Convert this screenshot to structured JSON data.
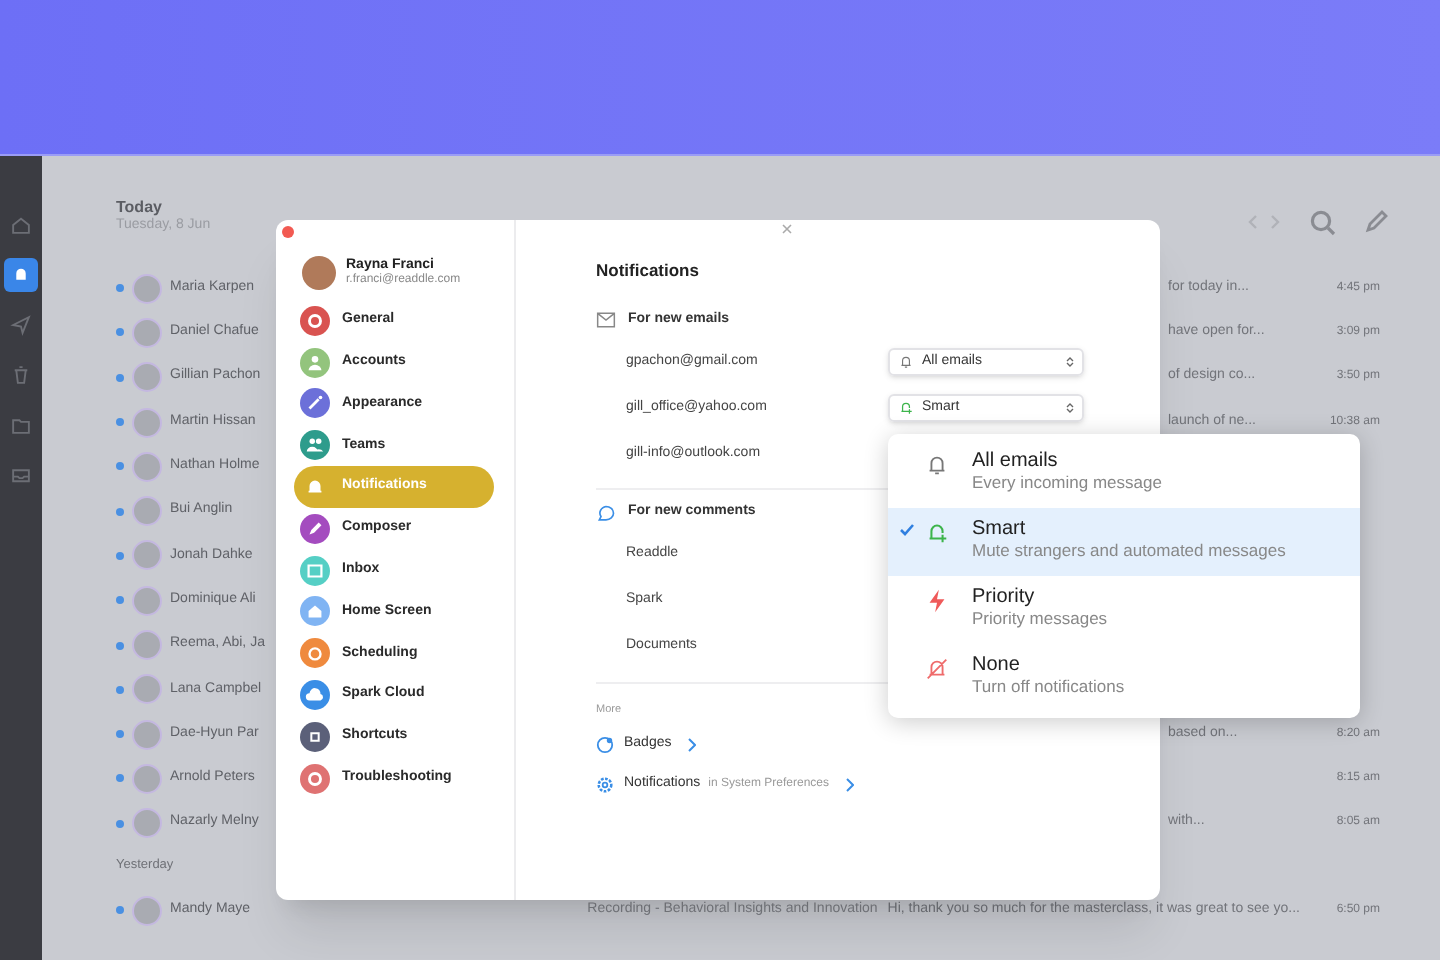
{
  "rail_items": [
    {
      "kind": "home",
      "selected": false
    },
    {
      "kind": "bell",
      "selected": true
    },
    {
      "kind": "send",
      "selected": false
    },
    {
      "kind": "trash",
      "selected": false
    },
    {
      "kind": "folder",
      "selected": false
    },
    {
      "kind": "tray",
      "selected": false
    }
  ],
  "mail_list": {
    "today_label": "Today",
    "date": "Tuesday, 8 Jun",
    "rows": [
      {
        "name": "Maria Karpen",
        "snippet": "for today in...",
        "time": "4:45 pm",
        "unread": true
      },
      {
        "name": "Daniel Chafue",
        "snippet": "have open for...",
        "time": "3:09 pm",
        "unread": true
      },
      {
        "name": "Gillian Pachon",
        "snippet": "of design co...",
        "time": "3:50 pm",
        "unread": true
      },
      {
        "name": "Martin Hissan",
        "snippet": "launch of ne...",
        "time": "10:38 am",
        "unread": true
      },
      {
        "name": "Nathan Holme",
        "unread": true
      },
      {
        "name": "Bui Anglin",
        "unread": true
      },
      {
        "name": "Jonah Dahke",
        "unread": true
      },
      {
        "name": "Dominique Ali",
        "unread": true
      },
      {
        "name": "Reema, Abi, Ja",
        "unread": true
      },
      {
        "name": "Lana Campbel",
        "unread": true
      },
      {
        "name": "Dae-Hyun Par",
        "snippet": "based on...",
        "time": "8:20 am",
        "unread": true
      },
      {
        "name": "Arnold Peters",
        "time": "8:15 am",
        "unread": true
      },
      {
        "name": "Nazarly Melny",
        "snippet": "with...",
        "time": "8:05 am",
        "unread": true
      }
    ],
    "yesterday_label": "Yesterday",
    "yesterday_rows": [
      {
        "name": "Mandy Maye",
        "subject": "Recording - Behavioral Insights and Innovation",
        "snippet": "Hi, thank you so much for the masterclass, it was great to see yo...",
        "time": "6:50 pm",
        "unread": true
      }
    ]
  },
  "settings": {
    "account": {
      "name": "Rayna Franci",
      "email": "r.franci@readdle.com"
    },
    "nav": [
      {
        "label": "General",
        "color": "#d95350",
        "selected": false
      },
      {
        "label": "Accounts",
        "color": "#93c47d",
        "selected": false
      },
      {
        "label": "Appearance",
        "color": "#6c70d9",
        "selected": false
      },
      {
        "label": "Teams",
        "color": "#2e9c8c",
        "selected": false
      },
      {
        "label": "Notifications",
        "color": "#d6b12f",
        "selected": true
      },
      {
        "label": "Composer",
        "color": "#a44cbf",
        "selected": false
      },
      {
        "label": "Inbox",
        "color": "#55cfc5",
        "selected": false
      },
      {
        "label": "Home Screen",
        "color": "#80b4f3",
        "selected": false
      },
      {
        "label": "Scheduling",
        "color": "#ef8a3e",
        "selected": false
      },
      {
        "label": "Spark Cloud",
        "color": "#3a8ee6",
        "selected": false
      },
      {
        "label": "Shortcuts",
        "color": "#5b6079",
        "selected": false
      },
      {
        "label": "Troubleshooting",
        "color": "#df7272",
        "selected": false
      }
    ],
    "title": "Notifications",
    "sections": [
      {
        "kind": "email",
        "heading": "For new emails",
        "rows": [
          {
            "label": "gpachon@gmail.com",
            "value": {
              "kind": "all",
              "text": "All emails"
            }
          },
          {
            "label": "gill_office@yahoo.com",
            "value": {
              "kind": "smart",
              "text": "Smart"
            }
          },
          {
            "label": "gill-info@outlook.com"
          }
        ]
      },
      {
        "kind": "comment",
        "heading": "For new comments",
        "rows": [
          {
            "label": "Readdle"
          },
          {
            "label": "Spark"
          },
          {
            "label": "Documents"
          }
        ]
      }
    ],
    "more": {
      "heading": "More",
      "links": [
        {
          "kind": "badges",
          "label": "Badges"
        },
        {
          "kind": "system",
          "label": "Notifications",
          "hint": "in System Preferences"
        }
      ]
    }
  },
  "dropdown": {
    "options": [
      {
        "kind": "all",
        "title": "All emails",
        "subtitle": "Every incoming message",
        "selected": false
      },
      {
        "kind": "smart",
        "title": "Smart",
        "subtitle": "Mute strangers and automated messages",
        "selected": true
      },
      {
        "kind": "priority",
        "title": "Priority",
        "subtitle": "Priority messages",
        "selected": false
      },
      {
        "kind": "none",
        "title": "None",
        "subtitle": "Turn off notifications",
        "selected": false
      }
    ]
  }
}
